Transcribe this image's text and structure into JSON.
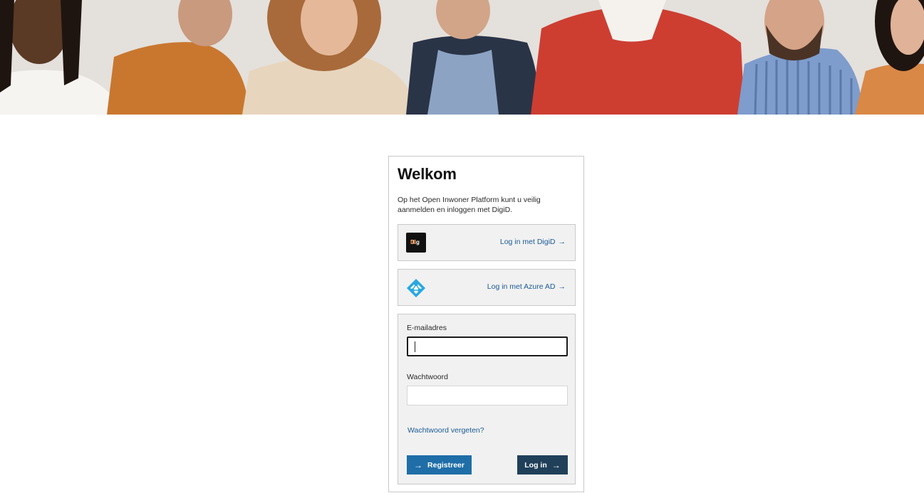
{
  "hero": {
    "image": "group-of-smiling-people-photo"
  },
  "card": {
    "title": "Welkom",
    "intro": "Op het Open Inwoner Platform kunt u veilig aanmelden en inloggen met DigiD."
  },
  "providers": {
    "digid": {
      "label": "Log in met DigiD",
      "arrow": "→",
      "logo_text_a": "Dig",
      "logo_text_b": "iD"
    },
    "azure": {
      "label": "Log in met Azure AD",
      "arrow": "→"
    }
  },
  "form": {
    "email_label": "E-mailadres",
    "email_value": "",
    "password_label": "Wachtwoord",
    "password_value": "",
    "forgot_link": "Wachtwoord vergeten?",
    "register_button": "Registreer",
    "login_button": "Log in",
    "arrow": "→"
  },
  "colors": {
    "link": "#1a5a96",
    "register_bg": "#1f6ea8",
    "login_bg": "#20405a",
    "digid_accent": "#e6711f",
    "azure_blue": "#29a8e0"
  }
}
